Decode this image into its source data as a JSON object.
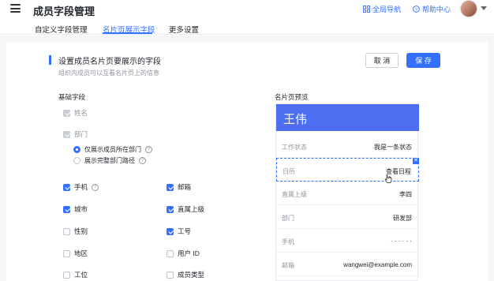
{
  "header": {
    "title": "成员字段管理",
    "global_nav": "全局导航",
    "help_center": "帮助中心"
  },
  "tabs": [
    {
      "label": "自定义字段管理"
    },
    {
      "label": "名片页展示字段",
      "active": true
    },
    {
      "label": "更多设置"
    }
  ],
  "section": {
    "title": "设置成员名片页要展示的字段",
    "subtitle": "组织内成员可以互看名片页上的信息",
    "cancel": "取 消",
    "save": "保 存"
  },
  "fields": {
    "group_label": "基础字段",
    "name": "姓名",
    "department": "部门",
    "dept_option_1": "仅展示成员所在部门",
    "dept_option_2": "展示完整部门路径",
    "items": [
      {
        "label": "手机",
        "checked": true,
        "help": true
      },
      {
        "label": "邮箱",
        "checked": true
      },
      {
        "label": "城市",
        "checked": true
      },
      {
        "label": "直属上级",
        "checked": true
      },
      {
        "label": "性别",
        "checked": false
      },
      {
        "label": "工号",
        "checked": true
      },
      {
        "label": "地区",
        "checked": false
      },
      {
        "label": "用户 ID",
        "checked": false
      },
      {
        "label": "工位",
        "checked": false
      },
      {
        "label": "成员类型",
        "checked": false
      }
    ]
  },
  "preview": {
    "label": "名片页预览",
    "name": "王伟",
    "rows": [
      {
        "k": "工作状态",
        "v": "我是一条状态"
      },
      {
        "k": "日历",
        "v": "查看日程"
      },
      {
        "k": "直属上级",
        "v": "李四"
      },
      {
        "k": "部门",
        "v": "研发部"
      },
      {
        "k": "手机",
        "v": "· · · · · ·"
      },
      {
        "k": "邮箱",
        "v": "wangwei@example.com"
      }
    ]
  },
  "colors": {
    "accent": "#3370ff",
    "preview_header": "#4e6ef2"
  }
}
